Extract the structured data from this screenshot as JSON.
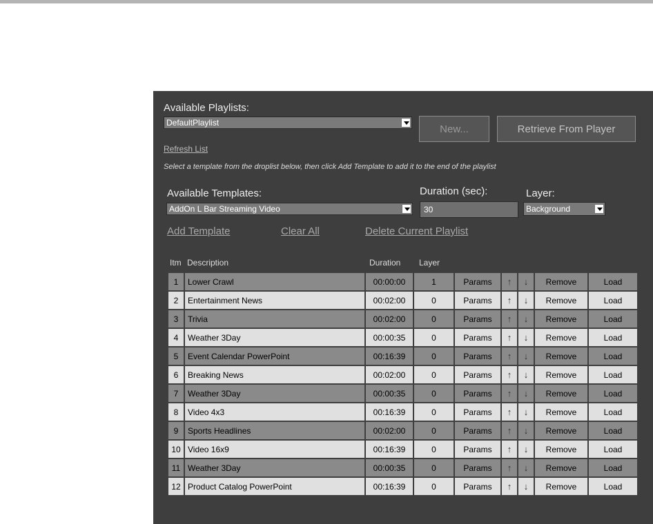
{
  "playlists": {
    "label": "Available Playlists:",
    "selected": "DefaultPlaylist",
    "new_label": "New...",
    "retrieve_label": "Retrieve From Player",
    "refresh_label": "Refresh List"
  },
  "instructions": "Select a template from the droplist below, then click Add Template to add it to the end of the playlist",
  "templates": {
    "label": "Available Templates:",
    "selected": "AddOn L Bar Streaming Video"
  },
  "duration": {
    "label": "Duration (sec):",
    "value": "30"
  },
  "layer": {
    "label": "Layer:",
    "selected": "Background"
  },
  "actions": {
    "add_template": "Add Template",
    "clear_all": "Clear All",
    "delete_playlist": "Delete Current Playlist"
  },
  "table": {
    "headers": {
      "item": "Itm",
      "description": "Description",
      "duration": "Duration",
      "layer": "Layer"
    },
    "params_label": "Params",
    "up_label": "↑",
    "down_label": "↓",
    "remove_label": "Remove",
    "load_label": "Load",
    "rows": [
      {
        "num": "1",
        "description": "Lower Crawl",
        "duration": "00:00:00",
        "layer": "1"
      },
      {
        "num": "2",
        "description": "Entertainment News",
        "duration": "00:02:00",
        "layer": "0"
      },
      {
        "num": "3",
        "description": "Trivia",
        "duration": "00:02:00",
        "layer": "0"
      },
      {
        "num": "4",
        "description": "Weather 3Day",
        "duration": "00:00:35",
        "layer": "0"
      },
      {
        "num": "5",
        "description": "Event Calendar PowerPoint",
        "duration": "00:16:39",
        "layer": "0"
      },
      {
        "num": "6",
        "description": "Breaking News",
        "duration": "00:02:00",
        "layer": "0"
      },
      {
        "num": "7",
        "description": "Weather 3Day",
        "duration": "00:00:35",
        "layer": "0"
      },
      {
        "num": "8",
        "description": "Video 4x3",
        "duration": "00:16:39",
        "layer": "0"
      },
      {
        "num": "9",
        "description": "Sports Headlines",
        "duration": "00:02:00",
        "layer": "0"
      },
      {
        "num": "10",
        "description": "Video 16x9",
        "duration": "00:16:39",
        "layer": "0"
      },
      {
        "num": "11",
        "description": "Weather 3Day",
        "duration": "00:00:35",
        "layer": "0"
      },
      {
        "num": "12",
        "description": "Product Catalog PowerPoint",
        "duration": "00:16:39",
        "layer": "0"
      }
    ]
  }
}
